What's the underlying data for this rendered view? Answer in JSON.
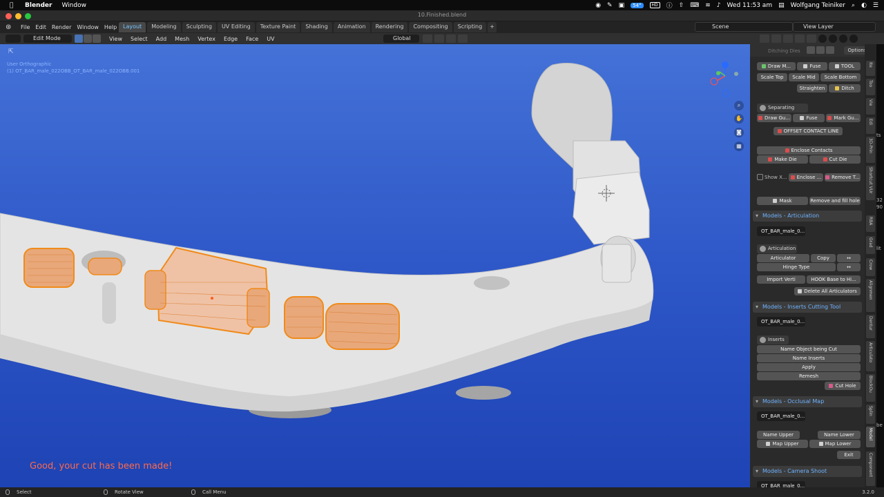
{
  "mac_menu": {
    "app": "Blender",
    "items": [
      "Window"
    ],
    "battery_badge": "54°",
    "hd_badge": "HD",
    "clock": "Wed 11:53 am",
    "user": "Wolfgang Teiniker"
  },
  "window": {
    "title": "10.Finished.blend"
  },
  "top_menu": {
    "items": [
      "File",
      "Edit",
      "Render",
      "Window",
      "Help"
    ],
    "tabs": [
      "Layout",
      "Modeling",
      "Sculpting",
      "UV Editing",
      "Texture Paint",
      "Shading",
      "Animation",
      "Rendering",
      "Compositing",
      "Scripting"
    ],
    "active_tab": "Layout",
    "plus": "+",
    "scene": "Scene",
    "view_layer": "View Layer"
  },
  "editor_header": {
    "mode": "Edit Mode",
    "menus": [
      "View",
      "Select",
      "Add",
      "Mesh",
      "Vertex",
      "Edge",
      "Face",
      "UV"
    ],
    "orientation": "Global"
  },
  "viewport": {
    "view_name": "User Orthographic",
    "object_info": "(1) OT_BAR_male_022OBB_OT_BAR_male_022OBB.001",
    "message": "Good, your cut has been made!",
    "colors": {
      "background_top": "#4472d7",
      "background_bottom": "#1e43b4",
      "selection": "#f0902a",
      "mesh": "#e0e0e0"
    }
  },
  "npanel": {
    "options": "Options",
    "partial_header": "Ditching Dies",
    "ditching": {
      "row1": [
        "Draw M...",
        "Fuse",
        "TOOL"
      ],
      "row2": [
        "Scale Top",
        "Scale Mid",
        "Scale Bottom"
      ],
      "row3": [
        "Straighten",
        "Ditch"
      ]
    },
    "separating": {
      "label": "Separating Teeth",
      "row1": [
        "Draw Gu...",
        "Fuse",
        "Mark Gu..."
      ],
      "offset": "OFFSET CONTACT LINE",
      "enclose_contacts": "Enclose Contacts",
      "row2": [
        "Make Die",
        "Cut Die"
      ],
      "show_label": "Show X...",
      "row3": [
        "Enclose ...",
        "Remove T..."
      ],
      "row4": [
        "Mask",
        "Remove and fill hole"
      ]
    },
    "articulation": {
      "section": "Models - Articulation",
      "object": "OT_BAR_male_0...",
      "label": "Articulation",
      "articulator": "Articulator",
      "copy": "Copy",
      "hinge": "Hinge Type",
      "import": "Import Verti",
      "hook": "HOOK Base to Hi...",
      "delete": "Delete All Articulators"
    },
    "inserts": {
      "section": "Models - Inserts Cutting Tool",
      "object": "OT_BAR_male_0...",
      "label": "Inserts",
      "buttons": [
        "Name Object being Cut",
        "Name Inserts",
        "Apply",
        "Remesh"
      ],
      "cut_hole": "Cut Hole"
    },
    "occlusal": {
      "section": "Models - Occlusal Map",
      "object": "OT_BAR_male_0...",
      "row1": [
        "Name Upper",
        "Name Lower"
      ],
      "row2": [
        "Map Upper",
        "Map Lower"
      ],
      "exit": "Exit"
    },
    "camera": {
      "section": "Models - Camera Shoot",
      "object": "OT_BAR_male_0..."
    }
  },
  "vertical_tabs": [
    "Ite",
    "Too",
    "Vie",
    "Edi",
    "3D-Prin",
    "Shortcut VUr",
    "RBA",
    "Grad",
    "Crow",
    "Alignmen",
    "Dentur",
    "Articulato",
    "BlockOu",
    "Splin",
    "Model",
    "Component"
  ],
  "active_vertical_tab": "Model",
  "edge_text": [
    "ts",
    "32",
    "90",
    "lit",
    "be"
  ],
  "status_bar": {
    "items": [
      "Select",
      "Rotate View",
      "Call Menu"
    ],
    "version": "3.2.0"
  }
}
